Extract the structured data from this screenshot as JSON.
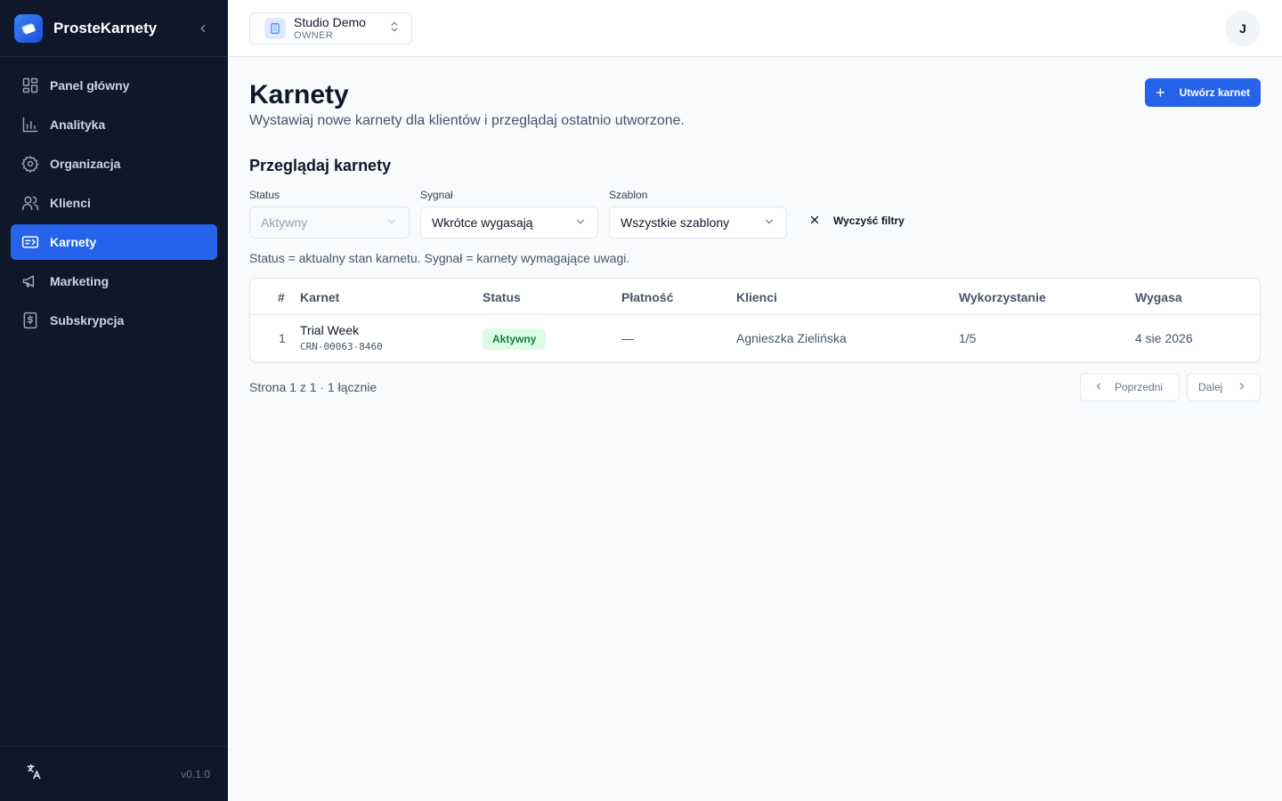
{
  "app": {
    "name": "ProsteKarnety",
    "version": "v0.1.0"
  },
  "sidebar": {
    "items": [
      {
        "label": "Panel główny",
        "icon": "dashboard-icon"
      },
      {
        "label": "Analityka",
        "icon": "chart-icon"
      },
      {
        "label": "Organizacja",
        "icon": "gear-icon"
      },
      {
        "label": "Klienci",
        "icon": "users-icon"
      },
      {
        "label": "Karnety",
        "icon": "ticket-icon",
        "active": true
      },
      {
        "label": "Marketing",
        "icon": "megaphone-icon"
      },
      {
        "label": "Subskrypcja",
        "icon": "dollar-icon"
      }
    ]
  },
  "topbar": {
    "org_name": "Studio Demo",
    "org_role": "OWNER",
    "avatar_initial": "J"
  },
  "page": {
    "title": "Karnety",
    "subtitle": "Wystawiaj nowe karnety dla klientów i przeglądaj ostatnio utworzone.",
    "create_label": "Utwórz karnet",
    "section_title": "Przeglądaj karnety"
  },
  "filters": {
    "status": {
      "label": "Status",
      "value": "Aktywny"
    },
    "signal": {
      "label": "Sygnał",
      "value": "Wkrótce wygasają"
    },
    "template": {
      "label": "Szablon",
      "value": "Wszystkie szablony"
    },
    "clear_label": "Wyczyść filtry",
    "hint": "Status = aktualny stan karnetu. Sygnał = karnety wymagające uwagi."
  },
  "table": {
    "columns": [
      "#",
      "Karnet",
      "Status",
      "Płatność",
      "Klienci",
      "Wykorzystanie",
      "Wygasa"
    ],
    "rows": [
      {
        "num": "1",
        "name": "Trial Week",
        "code": "CRN-00063-8460",
        "status": "Aktywny",
        "payment": "—",
        "clients": "Agnieszka Zielińska",
        "usage": "1/5",
        "expires": "4 sie 2026"
      }
    ]
  },
  "pagination": {
    "text": "Strona 1 z 1 · 1 łącznie",
    "prev_label": "Poprzedni",
    "next_label": "Dalej"
  },
  "colors": {
    "sidebar_bg": "#0f172a",
    "accent": "#2563eb",
    "status_active_bg": "#dcfce7",
    "status_active_fg": "#15803d"
  }
}
